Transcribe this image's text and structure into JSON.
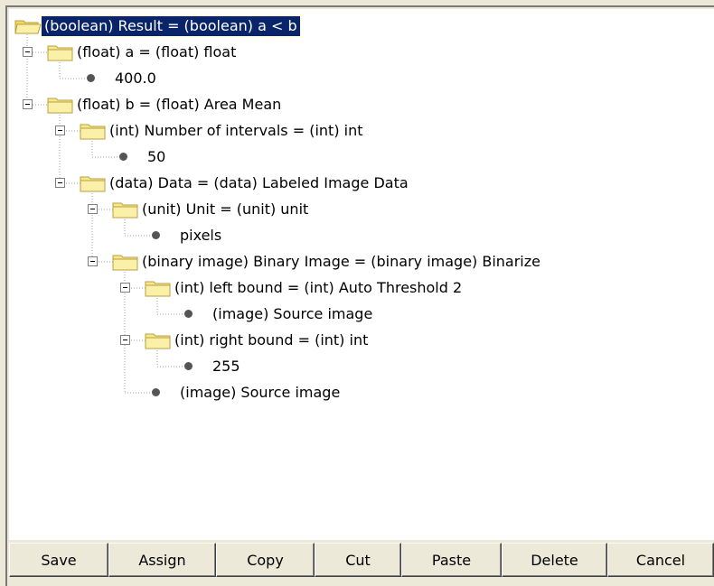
{
  "tree": {
    "nodes": [
      {
        "label": "(boolean) Result = (boolean) a < b",
        "icon": "folder-icon",
        "selected": true
      },
      {
        "label": "(float) a = (float) float",
        "icon": "folder-icon"
      },
      {
        "label": "400.0",
        "icon": "bullet-icon"
      },
      {
        "label": "(float) b = (float) Area Mean",
        "icon": "folder-icon"
      },
      {
        "label": "(int) Number of intervals = (int) int",
        "icon": "folder-icon"
      },
      {
        "label": "50",
        "icon": "bullet-icon"
      },
      {
        "label": "(data) Data = (data) Labeled Image Data",
        "icon": "folder-icon"
      },
      {
        "label": "(unit) Unit = (unit) unit",
        "icon": "folder-icon"
      },
      {
        "label": "pixels",
        "icon": "bullet-icon"
      },
      {
        "label": "(binary image) Binary Image = (binary image) Binarize",
        "icon": "folder-icon"
      },
      {
        "label": "(int) left bound = (int) Auto Threshold 2",
        "icon": "folder-icon"
      },
      {
        "label": "(image) Source image",
        "icon": "bullet-icon"
      },
      {
        "label": "(int) right bound = (int) int",
        "icon": "folder-icon"
      },
      {
        "label": "255",
        "icon": "bullet-icon"
      },
      {
        "label": "(image) Source image",
        "icon": "bullet-icon"
      }
    ]
  },
  "buttons": {
    "save": "Save",
    "assign": "Assign",
    "copy": "Copy",
    "cut": "Cut",
    "paste": "Paste",
    "delete": "Delete",
    "cancel": "Cancel"
  },
  "colors": {
    "selection": "#0a246a",
    "folder": "#f7e88c",
    "window_bg": "#ece9d8"
  }
}
